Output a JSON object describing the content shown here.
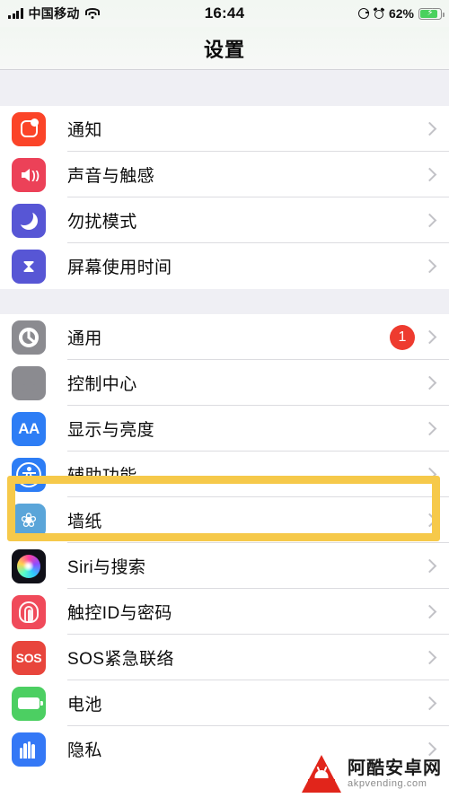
{
  "status_bar": {
    "signal_icon": "signal-bars-icon",
    "carrier": "中国移动",
    "wifi_icon": "wifi-icon",
    "time": "16:44",
    "rotation_lock_icon": "rotation-lock-icon",
    "alarm_icon": "alarm-clock-icon",
    "battery_percent": "62%",
    "battery_icon": "battery-charging-icon"
  },
  "navbar": {
    "title": "设置"
  },
  "groups": [
    {
      "rows": [
        {
          "label": "通知",
          "icon": "notifications-icon",
          "badge": null,
          "chevron": true
        },
        {
          "label": "声音与触感",
          "icon": "sounds-haptics-icon",
          "badge": null,
          "chevron": true
        },
        {
          "label": "勿扰模式",
          "icon": "do-not-disturb-icon",
          "badge": null,
          "chevron": true
        },
        {
          "label": "屏幕使用时间",
          "icon": "screen-time-icon",
          "badge": null,
          "chevron": true
        }
      ]
    },
    {
      "rows": [
        {
          "label": "通用",
          "icon": "general-gear-icon",
          "badge": "1",
          "chevron": true
        },
        {
          "label": "控制中心",
          "icon": "control-center-icon",
          "badge": null,
          "chevron": true
        },
        {
          "label": "显示与亮度",
          "icon": "display-brightness-icon",
          "badge": null,
          "chevron": true
        },
        {
          "label": "辅助功能",
          "icon": "accessibility-icon",
          "badge": null,
          "chevron": true
        },
        {
          "label": "墙纸",
          "icon": "wallpaper-icon",
          "badge": null,
          "chevron": true
        },
        {
          "label": "Siri与搜索",
          "icon": "siri-search-icon",
          "badge": null,
          "chevron": true
        },
        {
          "label": "触控ID与密码",
          "icon": "touch-id-passcode-icon",
          "badge": null,
          "chevron": true
        },
        {
          "label": "SOS紧急联络",
          "icon": "emergency-sos-icon",
          "badge": null,
          "chevron": true
        },
        {
          "label": "电池",
          "icon": "battery-icon",
          "badge": null,
          "chevron": true
        },
        {
          "label": "隐私",
          "icon": "privacy-icon",
          "badge": null,
          "chevron": true
        }
      ]
    }
  ],
  "highlight": {
    "target_label": "辅助功能",
    "color": "#f6c94a"
  },
  "watermark": {
    "logo": "android-a-logo",
    "site_cn": "阿酷安卓网",
    "site_en": "akpvending.com"
  },
  "colors": {
    "list_background": "#ffffff",
    "group_gap": "#efeff4",
    "separator": "#dcdce0",
    "chevron": "#c2c2c7",
    "badge": "#ee3b2f",
    "highlight": "#f6c94a"
  }
}
